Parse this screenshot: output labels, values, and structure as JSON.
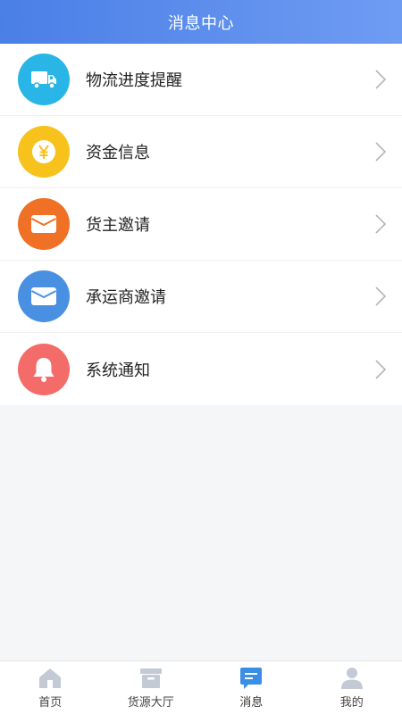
{
  "header": {
    "title": "消息中心"
  },
  "list": {
    "items": [
      {
        "label": "物流进度提醒",
        "icon": "truck-icon",
        "color": "#29b6e6"
      },
      {
        "label": "资金信息",
        "icon": "yen-icon",
        "color": "#f7c21b"
      },
      {
        "label": "货主邀请",
        "icon": "envelope-icon",
        "color": "#f07126"
      },
      {
        "label": "承运商邀请",
        "icon": "envelope-icon",
        "color": "#4a90e2"
      },
      {
        "label": "系统通知",
        "icon": "bell-icon",
        "color": "#f46c69"
      }
    ]
  },
  "tabbar": {
    "tabs": [
      {
        "label": "首页",
        "icon": "home-icon",
        "active": false
      },
      {
        "label": "货源大厅",
        "icon": "archive-box-icon",
        "active": false
      },
      {
        "label": "消息",
        "icon": "message-icon",
        "active": true
      },
      {
        "label": "我的",
        "icon": "user-icon",
        "active": false
      }
    ],
    "active_color": "#3a8ee6",
    "inactive_color": "#c4c9d6"
  }
}
